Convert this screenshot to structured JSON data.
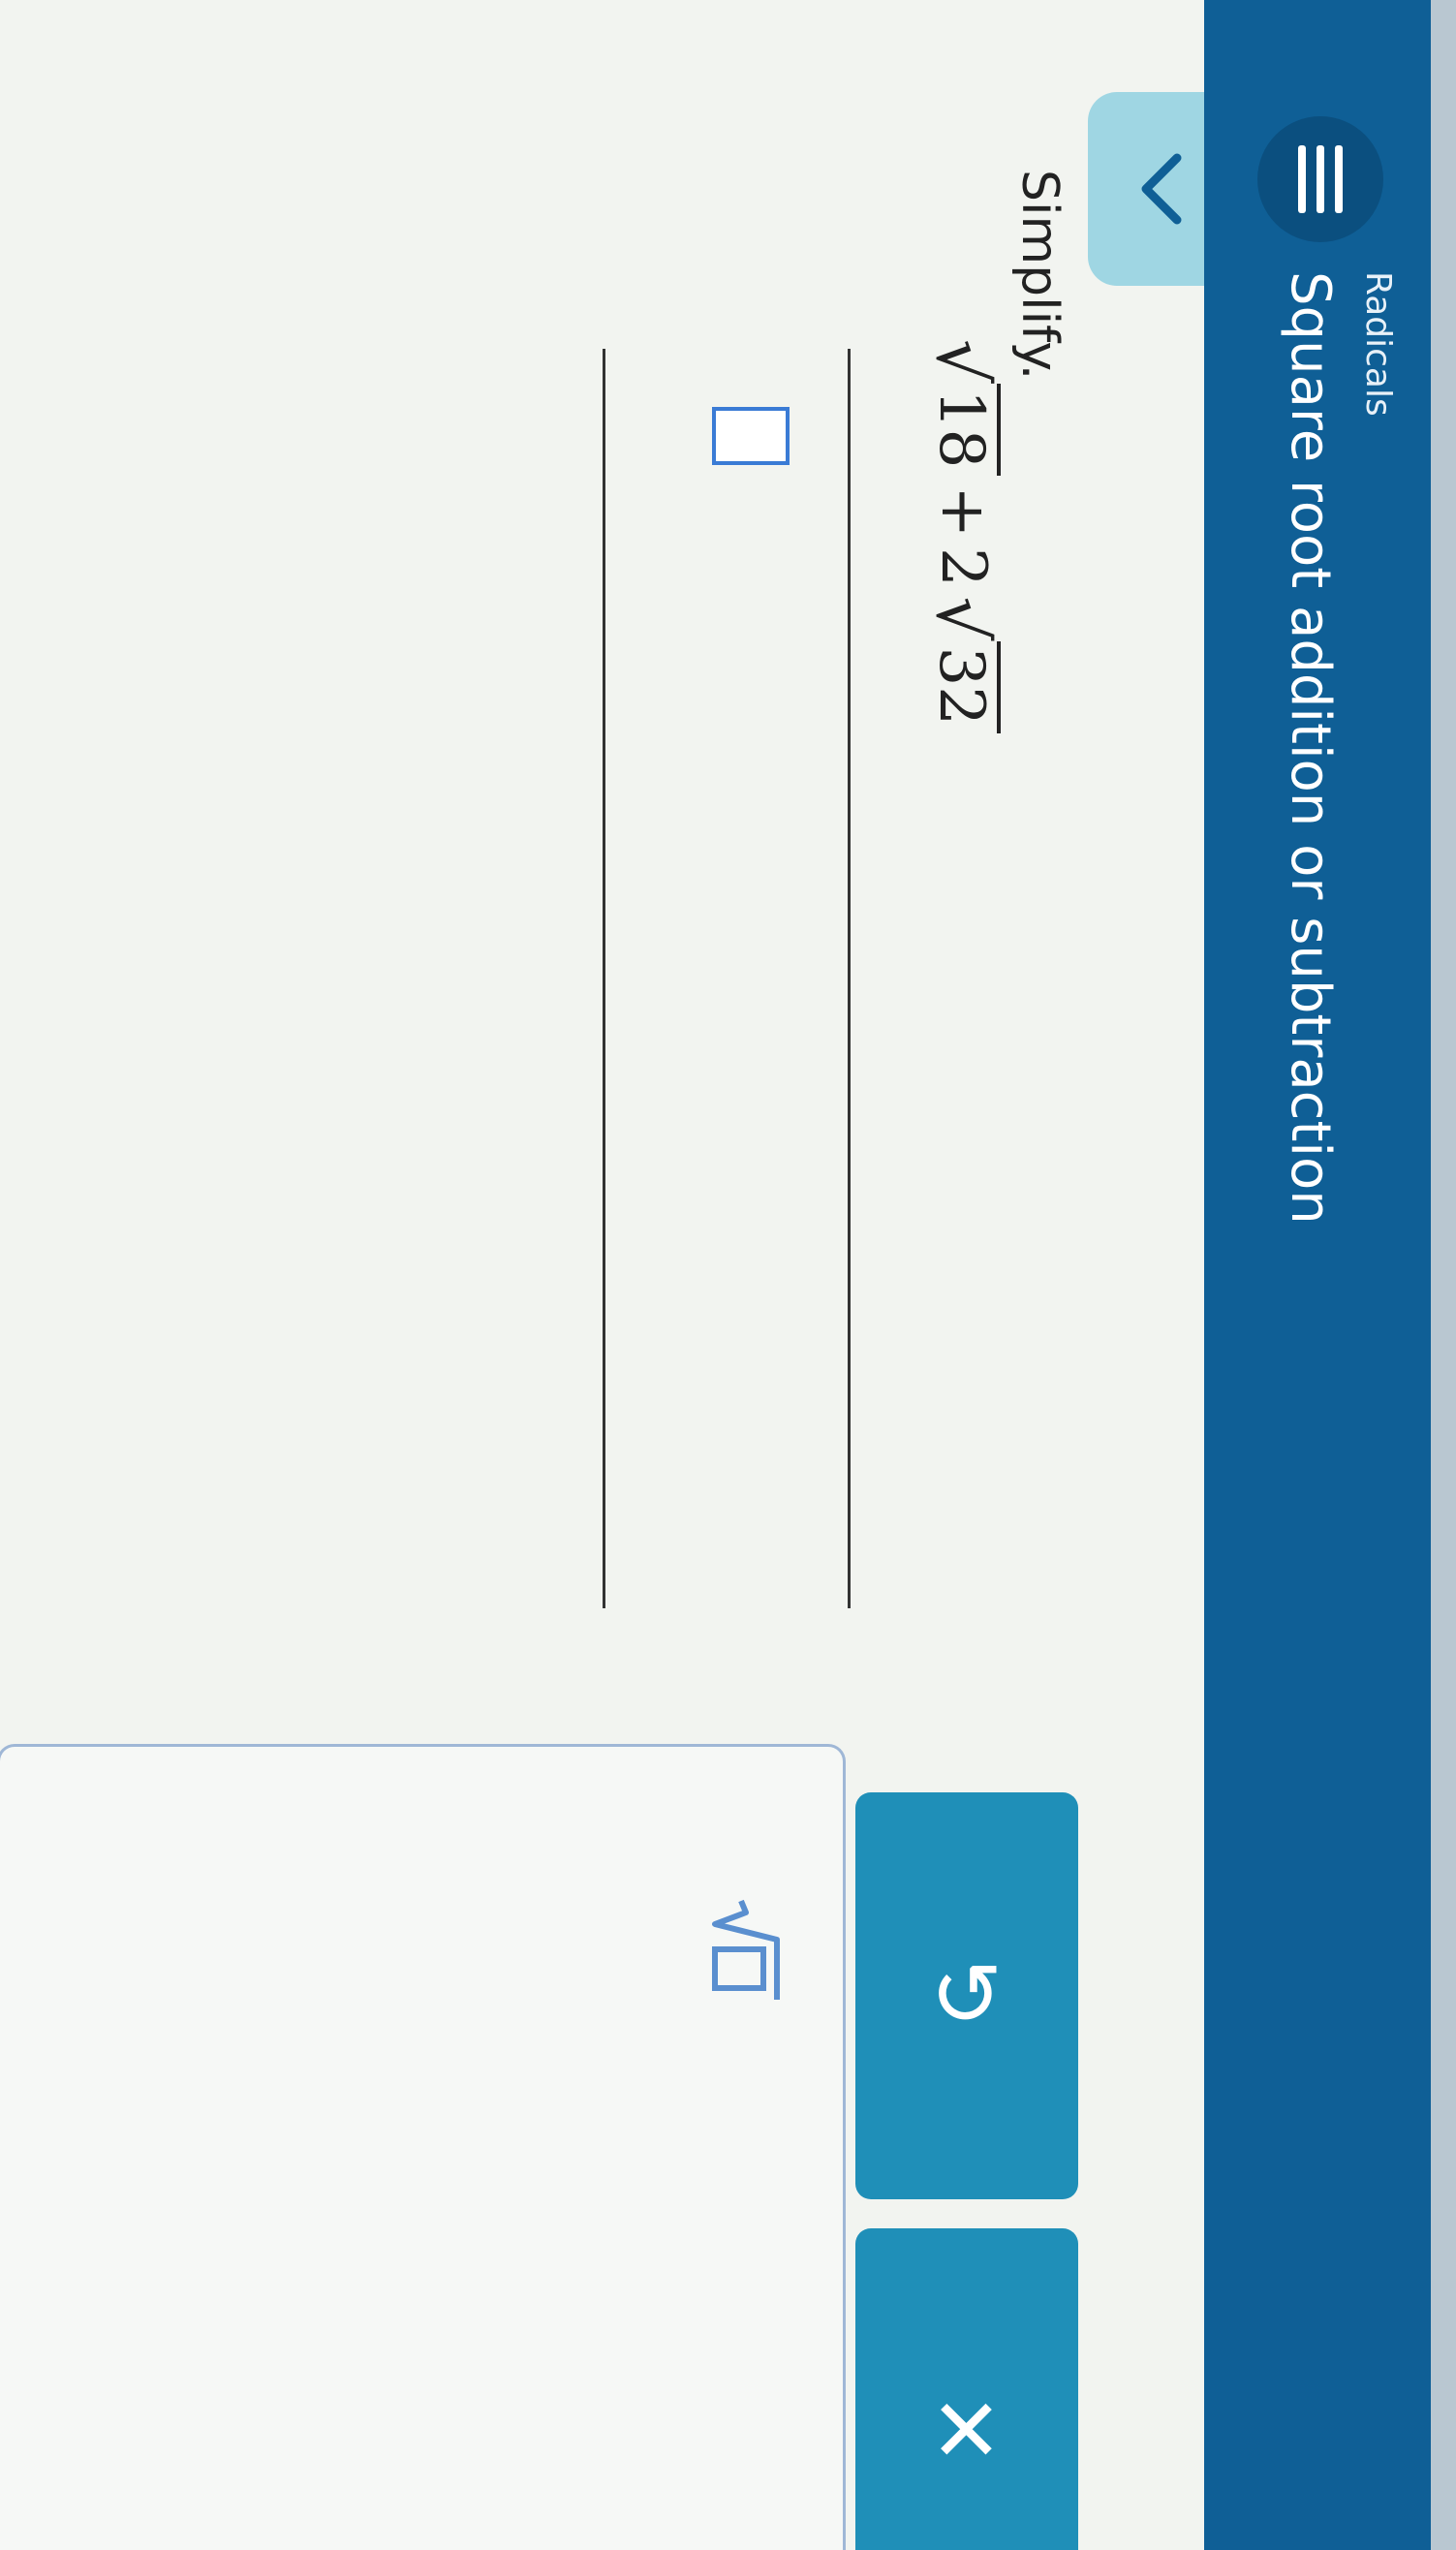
{
  "header": {
    "section": "Radicals",
    "title": "Square root addition or subtraction"
  },
  "question": {
    "prompt": "Simplify.",
    "term1_radicand": "18",
    "operator": "+",
    "term2_coefficient": "2",
    "term2_radicand": "32"
  },
  "keypad": {
    "sqrt_key_icon": "sqrt-template-icon",
    "undo_icon": "undo-icon",
    "undo_glyph": "↺",
    "clear_icon": "close-icon",
    "clear_glyph": "✕"
  },
  "colors": {
    "header": "#0f5f96",
    "accent_button": "#1f8fb8",
    "answer_box": "#3a7bd5"
  }
}
